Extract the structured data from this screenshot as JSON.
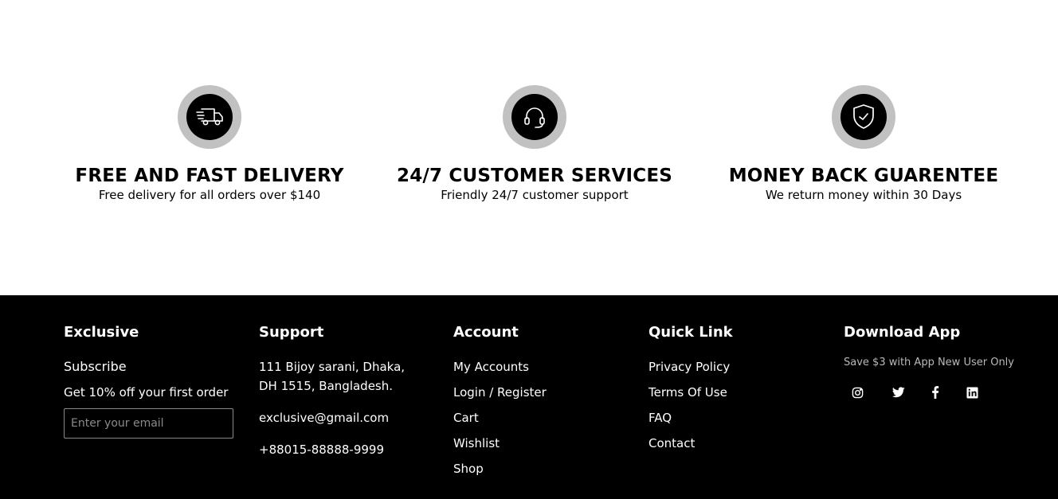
{
  "services": [
    {
      "icon": "delivery-truck-icon",
      "title": "FREE AND FAST DELIVERY",
      "description": "Free delivery for all orders over $140"
    },
    {
      "icon": "headset-icon",
      "title": "24/7 CUSTOMER SERVICES",
      "description": "Friendly 24/7 customer support"
    },
    {
      "icon": "shield-check-icon",
      "title": "MONEY BACK GUARENTEE",
      "description": "We return money within 30 Days"
    }
  ],
  "footer": {
    "exclusive": {
      "heading": "Exclusive",
      "subscribe": "Subscribe",
      "offer": "Get 10% off your first order",
      "email_placeholder": "Enter your email"
    },
    "support": {
      "heading": "Support",
      "address": "111 Bijoy sarani, Dhaka, DH 1515, Bangladesh.",
      "email": "exclusive@gmail.com",
      "phone": "+88015-88888-9999"
    },
    "account": {
      "heading": "Account",
      "links": [
        "My Accounts",
        "Login / Register",
        "Cart",
        "Wishlist",
        "Shop"
      ]
    },
    "quick_link": {
      "heading": "Quick Link",
      "links": [
        "Privacy Policy",
        "Terms Of Use",
        "FAQ",
        "Contact"
      ]
    },
    "download_app": {
      "heading": "Download App",
      "note": "Save $3 with App New User Only",
      "socials": [
        "instagram-icon",
        "twitter-icon",
        "facebook-icon",
        "linkedin-icon"
      ]
    }
  },
  "colors": {
    "footer_bg": "#000000",
    "icon_ring": "#c1c1c1",
    "muted_text": "#b9b9b9"
  }
}
